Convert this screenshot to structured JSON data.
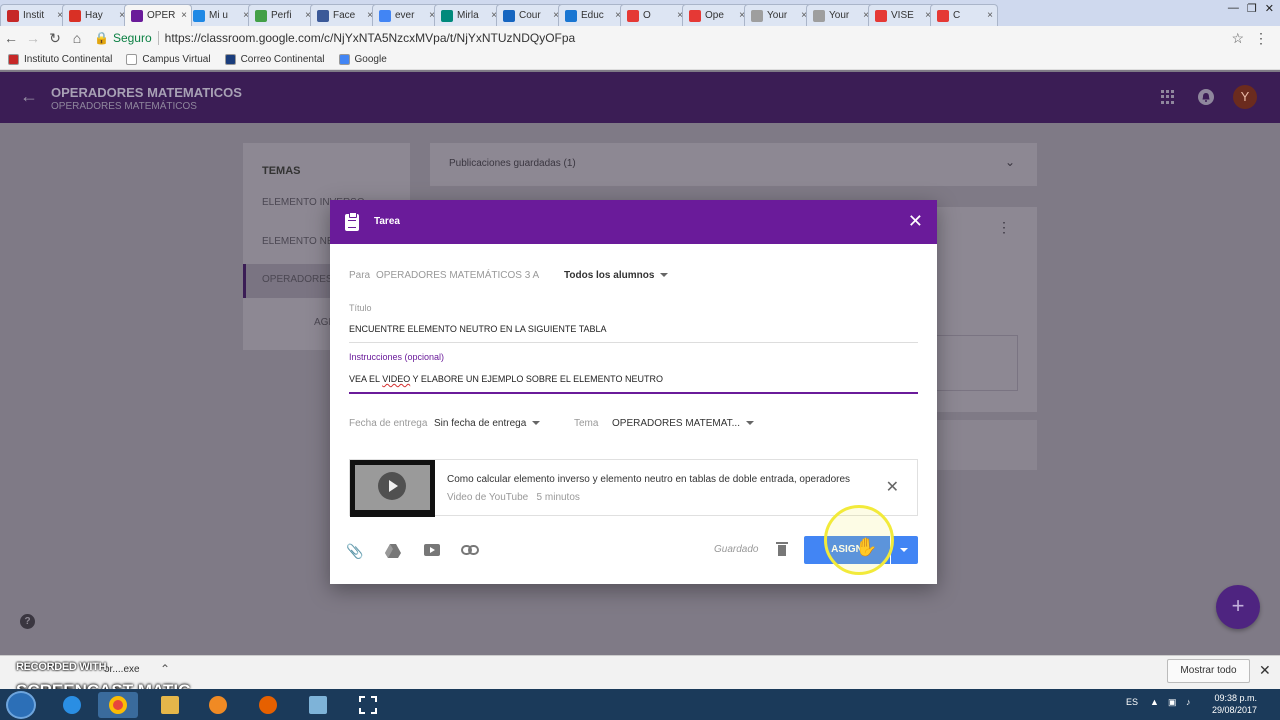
{
  "browser": {
    "tabs": [
      {
        "label": "Instit",
        "color": "#c62828"
      },
      {
        "label": "Hay",
        "color": "#d93025"
      },
      {
        "label": "OPER",
        "color": "#6a1b9a",
        "active": true
      },
      {
        "label": "Mi u",
        "color": "#1e88e5"
      },
      {
        "label": "Perfi",
        "color": "#43a047"
      },
      {
        "label": "Face",
        "color": "#3b5998"
      },
      {
        "label": "ever",
        "color": "#4285f4"
      },
      {
        "label": "Mirla",
        "color": "#00897b"
      },
      {
        "label": "Cour",
        "color": "#1565c0"
      },
      {
        "label": "Educ",
        "color": "#1976d2"
      },
      {
        "label": "O",
        "color": "#e53935"
      },
      {
        "label": "Ope",
        "color": "#e53935"
      },
      {
        "label": "Your",
        "color": "#9e9e9e"
      },
      {
        "label": "Your",
        "color": "#9e9e9e"
      },
      {
        "label": "VISE",
        "color": "#e53935"
      },
      {
        "label": "C",
        "color": "#e53935"
      }
    ],
    "secure_label": "Seguro",
    "url": "https://classroom.google.com/c/NjYxNTA5NzcxMVpa/t/NjYxNTUzNDQyOFpa",
    "bookmarks": [
      {
        "label": "Instituto Continental",
        "color": "#c62828"
      },
      {
        "label": "Campus Virtual",
        "color": "#ffffff"
      },
      {
        "label": "Correo Continental",
        "color": "#1a3d7c"
      },
      {
        "label": "Google",
        "color": "#4285f4"
      }
    ]
  },
  "classroom": {
    "title": "OPERADORES MATEMATICOS",
    "subtitle": "OPERADORES MATEMÁTICOS",
    "avatar": "Y",
    "sidebar": {
      "title": "TEMAS",
      "items": [
        "ELEMENTO INVERSO",
        "ELEMENTO NE",
        "OPERADORES"
      ],
      "add": "AGR"
    },
    "saved_posts": "Publicaciones guardadas (1)"
  },
  "dialog": {
    "title": "Tarea",
    "for_label": "Para",
    "class_name": "OPERADORES MATEMÁTICOS 3 A",
    "students": "Todos los alumnos",
    "title_label": "Título",
    "title_value": "ENCUENTRE ELEMENTO NEUTRO EN LA SIGUIENTE TABLA",
    "instructions_label": "Instrucciones (opcional)",
    "instructions_pre": "VEA EL ",
    "instructions_err": "VIDEO",
    "instructions_post": " Y ELABORE UN EJEMPLO SOBRE EL ELEMENTO NEUTRO",
    "due_label": "Fecha de entrega",
    "due_value": "Sin fecha de entrega",
    "topic_label": "Tema",
    "topic_value": "OPERADORES MATEMAT...",
    "attachment": {
      "title": "Como calcular elemento inverso y elemento neutro en tablas de doble entrada, operadores",
      "source": "Video de YouTube",
      "duration": "5 minutos"
    },
    "saved_status": "Guardado",
    "assign_label": "ASIGN"
  },
  "download_bar": {
    "file": "or....exe",
    "show_all": "Mostrar todo"
  },
  "watermark": {
    "line1": "RECORDED WITH",
    "line2": "SCREENCAST  MATIC"
  },
  "taskbar": {
    "lang": "ES",
    "time": "09:38 p.m.",
    "date": "29/08/2017"
  }
}
